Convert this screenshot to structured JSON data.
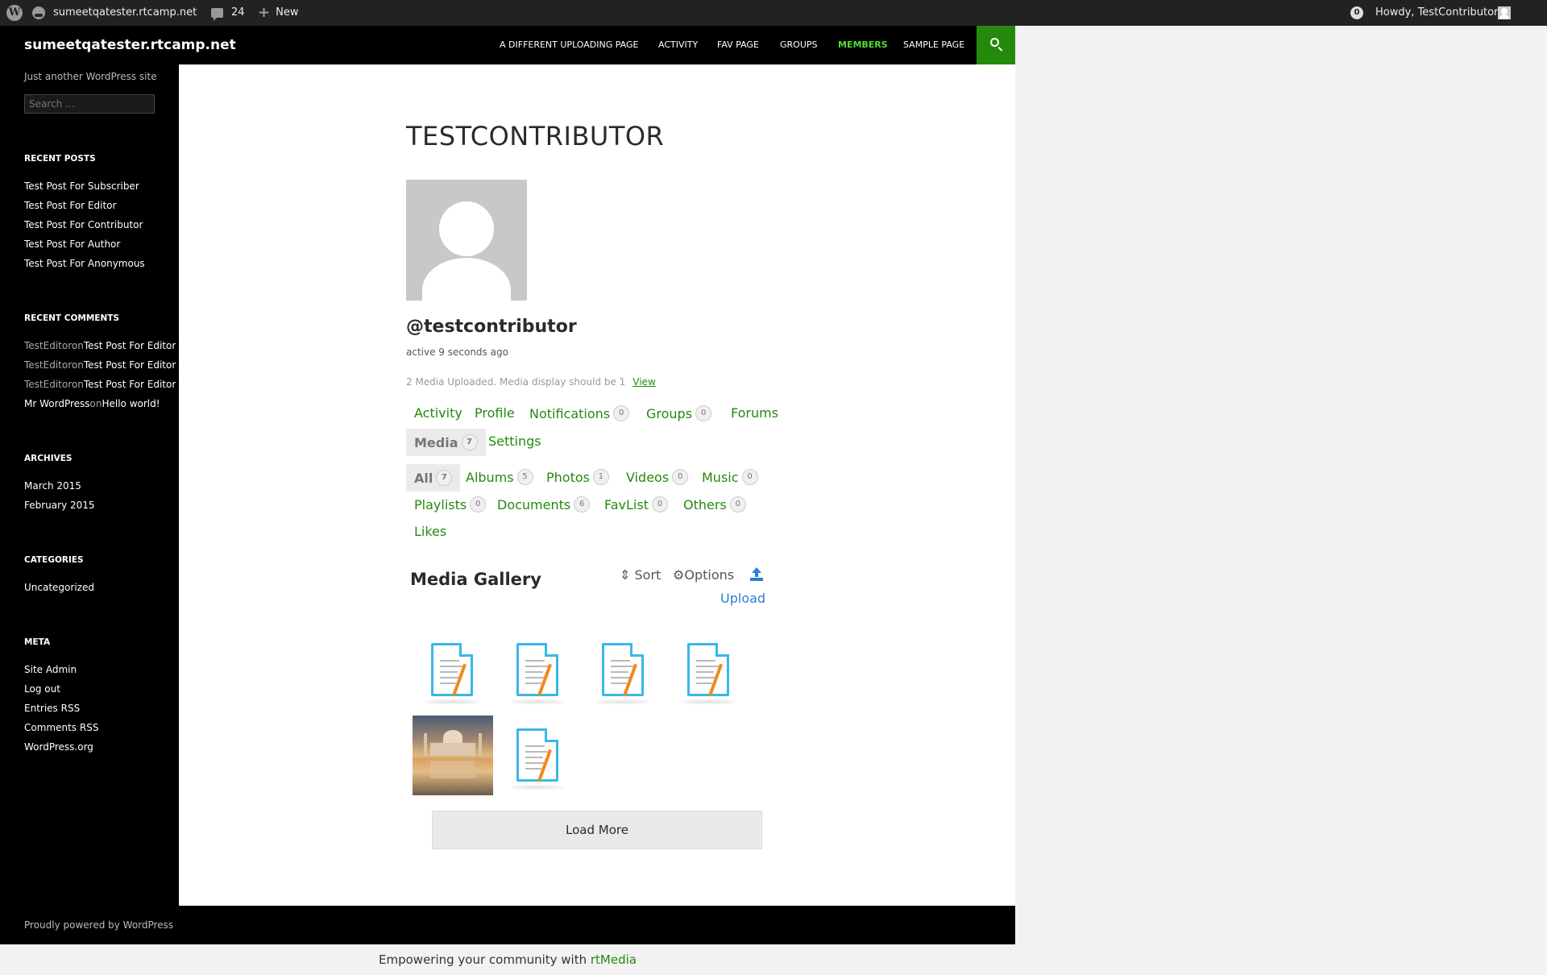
{
  "admin_bar": {
    "site_name": "sumeetqatester.rtcamp.net",
    "comments_count": "24",
    "new_label": "New",
    "notifications_count": "0",
    "howdy": "Howdy, TestContributor"
  },
  "header": {
    "site_title": "sumeetqatester.rtcamp.net",
    "nav": [
      "A DIFFERENT UPLOADING PAGE",
      "ACTIVITY",
      "FAV PAGE",
      "GROUPS",
      "MEMBERS",
      "SAMPLE PAGE"
    ],
    "active_nav": "MEMBERS"
  },
  "sidebar": {
    "description": "Just another WordPress site",
    "search_placeholder": "Search …",
    "recent_posts_title": "RECENT POSTS",
    "recent_posts": [
      "Test Post For Subscriber",
      "Test Post For Editor",
      "Test Post For Contributor",
      "Test Post For Author",
      "Test Post For Anonymous"
    ],
    "recent_comments_title": "RECENT COMMENTS",
    "recent_comments": [
      {
        "author": "TestEditor",
        "on": "on",
        "post": "Test Post For Editor"
      },
      {
        "author": "TestEditor",
        "on": "on",
        "post": "Test Post For Editor"
      },
      {
        "author": "TestEditor",
        "on": "on",
        "post": "Test Post For Editor"
      },
      {
        "author": "Mr WordPress",
        "on": "on",
        "post": "Hello world!"
      }
    ],
    "archives_title": "ARCHIVES",
    "archives": [
      "March 2015",
      "February 2015"
    ],
    "categories_title": "CATEGORIES",
    "categories": [
      "Uncategorized"
    ],
    "meta_title": "META",
    "meta": [
      "Site Admin",
      "Log out",
      "Entries",
      "RSS",
      "Comments",
      "RSS",
      "WordPress.org"
    ]
  },
  "profile": {
    "title": "TESTCONTRIBUTOR",
    "mention": "@testcontributor",
    "activity": "active 9 seconds ago",
    "media_note": "2 Media Uploaded. Media display should be 1",
    "view_link": "View"
  },
  "tabs": {
    "activity": "Activity",
    "profile": "Profile",
    "notifications": "Notifications",
    "notifications_count": "0",
    "groups": "Groups",
    "groups_count": "0",
    "forums": "Forums",
    "media": "Media",
    "media_count": "7",
    "settings": "Settings"
  },
  "media_tabs": {
    "all": "All",
    "all_count": "7",
    "albums": "Albums",
    "albums_count": "5",
    "photos": "Photos",
    "photos_count": "1",
    "videos": "Videos",
    "videos_count": "0",
    "music": "Music",
    "music_count": "0",
    "playlists": "Playlists",
    "playlists_count": "0",
    "documents": "Documents",
    "documents_count": "6",
    "favlist": "FavList",
    "favlist_count": "0",
    "others": "Others",
    "others_count": "0",
    "likes": "Likes"
  },
  "gallery": {
    "title": "Media Gallery",
    "sort": "Sort",
    "options": "Options",
    "upload": "Upload",
    "load_more": "Load More",
    "items": [
      "document-icon",
      "document-icon",
      "document-icon",
      "document-icon",
      "photo",
      "document-icon"
    ]
  },
  "footer": {
    "powered": "Proudly powered by WordPress",
    "rtmedia_prefix": "Empowering your community with ",
    "rtmedia_link": "rtMedia"
  },
  "colors": {
    "accent": "#24890d",
    "nav_active": "#55d737",
    "upload_blue": "#2a7fd4"
  }
}
